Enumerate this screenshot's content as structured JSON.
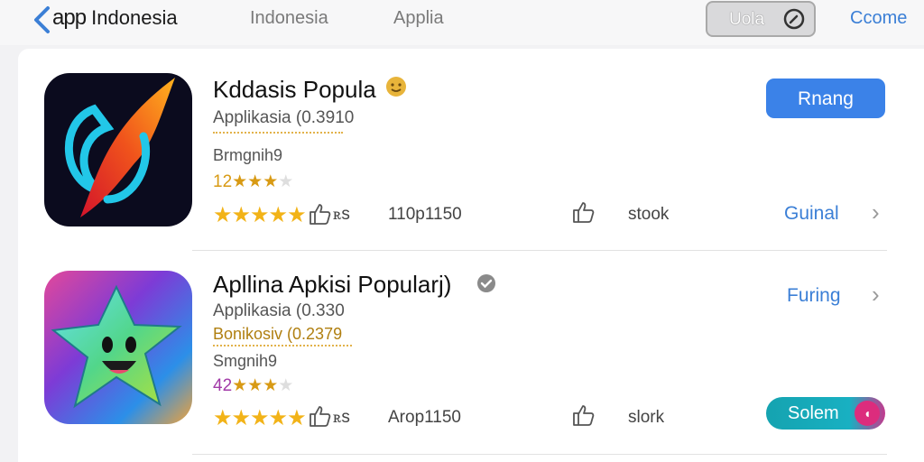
{
  "header": {
    "brand_app": "app",
    "brand_country": "Indonesia",
    "nav_items": [
      "Indonesia",
      "Applia"
    ],
    "pill_label": "Uola",
    "right_link": "Ccome"
  },
  "apps": [
    {
      "title": "Kddasis Popula",
      "subtitle": "Applikasia (0.3910",
      "developer": "Brmgnih9",
      "rating_label": "12",
      "rating_stars_small": "★★★",
      "stars": "★★★★★",
      "likes": "ꭱs",
      "downloads": "110p1150",
      "stock": "stook",
      "action_button": "Rnang",
      "side_link": "Guinal"
    },
    {
      "title": "Apllina Apkisi Popularj)",
      "subtitle": "Applikasia (0.330",
      "developer": "Bonikosiv (0.2379",
      "developer2": "Smgnih9",
      "rating_label": "42",
      "rating_stars_small": "★★★",
      "stars": "★★★★★",
      "likes": "ꭱs",
      "downloads": "Arop1150",
      "stock": "slork",
      "side_link": "Furing",
      "action_button": "Solem"
    }
  ],
  "colors": {
    "accent_blue": "#3b82e8",
    "link_blue": "#3b7fd6",
    "star_gold": "#f2b318",
    "teal": "#15a3b0",
    "pink": "#dc2c7d"
  },
  "icons": [
    "back-chevron-icon",
    "compass-icon",
    "thumbs-up-icon",
    "chevron-right-icon",
    "verified-badge-icon",
    "emoji-badge-icon"
  ]
}
